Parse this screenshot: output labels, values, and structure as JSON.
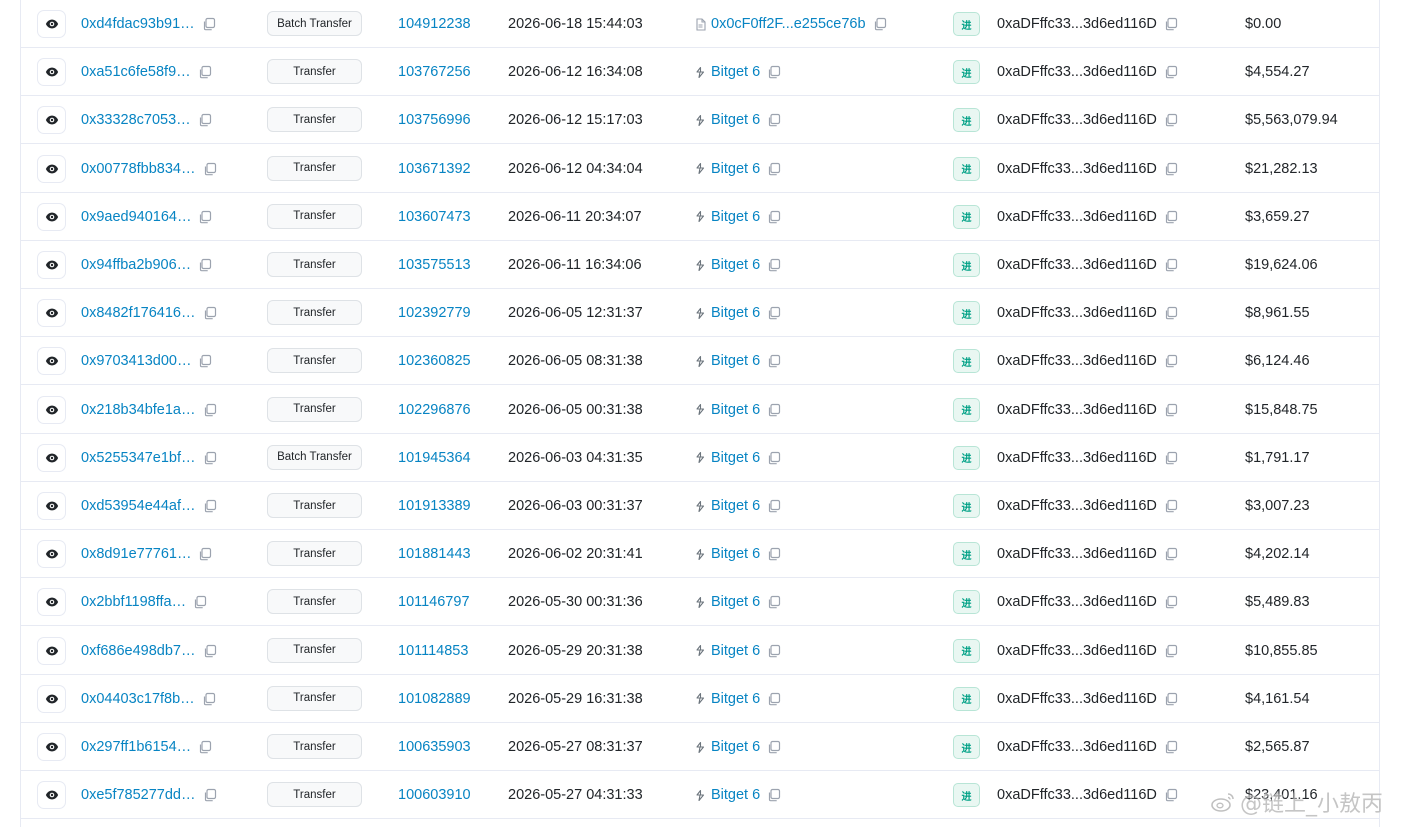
{
  "rows": [
    {
      "hash": "0xd4fdac93b91…",
      "method": "Batch Transfer",
      "block": "104912238",
      "age": "2026-06-18 15:44:03",
      "from": "0x0cF0ff2F...e255ce76b",
      "from_type": "contract",
      "direction": "进",
      "to": "0xaDFffc33...3d6ed116D",
      "value": "$0.00"
    },
    {
      "hash": "0xa51c6fe58f9…",
      "method": "Transfer",
      "block": "103767256",
      "age": "2026-06-12 16:34:08",
      "from": "Bitget 6",
      "from_type": "label",
      "direction": "进",
      "to": "0xaDFffc33...3d6ed116D",
      "value": "$4,554.27"
    },
    {
      "hash": "0x33328c7053…",
      "method": "Transfer",
      "block": "103756996",
      "age": "2026-06-12 15:17:03",
      "from": "Bitget 6",
      "from_type": "label",
      "direction": "进",
      "to": "0xaDFffc33...3d6ed116D",
      "value": "$5,563,079.94"
    },
    {
      "hash": "0x00778fbb834…",
      "method": "Transfer",
      "block": "103671392",
      "age": "2026-06-12 04:34:04",
      "from": "Bitget 6",
      "from_type": "label",
      "direction": "进",
      "to": "0xaDFffc33...3d6ed116D",
      "value": "$21,282.13"
    },
    {
      "hash": "0x9aed940164…",
      "method": "Transfer",
      "block": "103607473",
      "age": "2026-06-11 20:34:07",
      "from": "Bitget 6",
      "from_type": "label",
      "direction": "进",
      "to": "0xaDFffc33...3d6ed116D",
      "value": "$3,659.27"
    },
    {
      "hash": "0x94ffba2b906…",
      "method": "Transfer",
      "block": "103575513",
      "age": "2026-06-11 16:34:06",
      "from": "Bitget 6",
      "from_type": "label",
      "direction": "进",
      "to": "0xaDFffc33...3d6ed116D",
      "value": "$19,624.06"
    },
    {
      "hash": "0x8482f176416…",
      "method": "Transfer",
      "block": "102392779",
      "age": "2026-06-05 12:31:37",
      "from": "Bitget 6",
      "from_type": "label",
      "direction": "进",
      "to": "0xaDFffc33...3d6ed116D",
      "value": "$8,961.55"
    },
    {
      "hash": "0x9703413d00…",
      "method": "Transfer",
      "block": "102360825",
      "age": "2026-06-05 08:31:38",
      "from": "Bitget 6",
      "from_type": "label",
      "direction": "进",
      "to": "0xaDFffc33...3d6ed116D",
      "value": "$6,124.46"
    },
    {
      "hash": "0x218b34bfe1a…",
      "method": "Transfer",
      "block": "102296876",
      "age": "2026-06-05 00:31:38",
      "from": "Bitget 6",
      "from_type": "label",
      "direction": "进",
      "to": "0xaDFffc33...3d6ed116D",
      "value": "$15,848.75"
    },
    {
      "hash": "0x5255347e1bf…",
      "method": "Batch Transfer",
      "block": "101945364",
      "age": "2026-06-03 04:31:35",
      "from": "Bitget 6",
      "from_type": "label",
      "direction": "进",
      "to": "0xaDFffc33...3d6ed116D",
      "value": "$1,791.17"
    },
    {
      "hash": "0xd53954e44af…",
      "method": "Transfer",
      "block": "101913389",
      "age": "2026-06-03 00:31:37",
      "from": "Bitget 6",
      "from_type": "label",
      "direction": "进",
      "to": "0xaDFffc33...3d6ed116D",
      "value": "$3,007.23"
    },
    {
      "hash": "0x8d91e77761…",
      "method": "Transfer",
      "block": "101881443",
      "age": "2026-06-02 20:31:41",
      "from": "Bitget 6",
      "from_type": "label",
      "direction": "进",
      "to": "0xaDFffc33...3d6ed116D",
      "value": "$4,202.14"
    },
    {
      "hash": "0x2bbf1198ffa…",
      "method": "Transfer",
      "block": "101146797",
      "age": "2026-05-30 00:31:36",
      "from": "Bitget 6",
      "from_type": "label",
      "direction": "进",
      "to": "0xaDFffc33...3d6ed116D",
      "value": "$5,489.83"
    },
    {
      "hash": "0xf686e498db7…",
      "method": "Transfer",
      "block": "101114853",
      "age": "2026-05-29 20:31:38",
      "from": "Bitget 6",
      "from_type": "label",
      "direction": "进",
      "to": "0xaDFffc33...3d6ed116D",
      "value": "$10,855.85"
    },
    {
      "hash": "0x04403c17f8b…",
      "method": "Transfer",
      "block": "101082889",
      "age": "2026-05-29 16:31:38",
      "from": "Bitget 6",
      "from_type": "label",
      "direction": "进",
      "to": "0xaDFffc33...3d6ed116D",
      "value": "$4,161.54"
    },
    {
      "hash": "0x297ff1b6154…",
      "method": "Transfer",
      "block": "100635903",
      "age": "2026-05-27 08:31:37",
      "from": "Bitget 6",
      "from_type": "label",
      "direction": "进",
      "to": "0xaDFffc33...3d6ed116D",
      "value": "$2,565.87"
    },
    {
      "hash": "0xe5f785277dd…",
      "method": "Transfer",
      "block": "100603910",
      "age": "2026-05-27 04:31:33",
      "from": "Bitget 6",
      "from_type": "label",
      "direction": "进",
      "to": "0xaDFffc33...3d6ed116D",
      "value": "$23,401.16"
    }
  ],
  "watermark": {
    "text": "@链上_小敖丙",
    "icon": "weibo-logo-icon"
  },
  "colors": {
    "link": "#0784c3",
    "in_badge_bg": "#e9f7f2",
    "in_badge_text": "#00a186",
    "border": "#e7eaf3"
  }
}
